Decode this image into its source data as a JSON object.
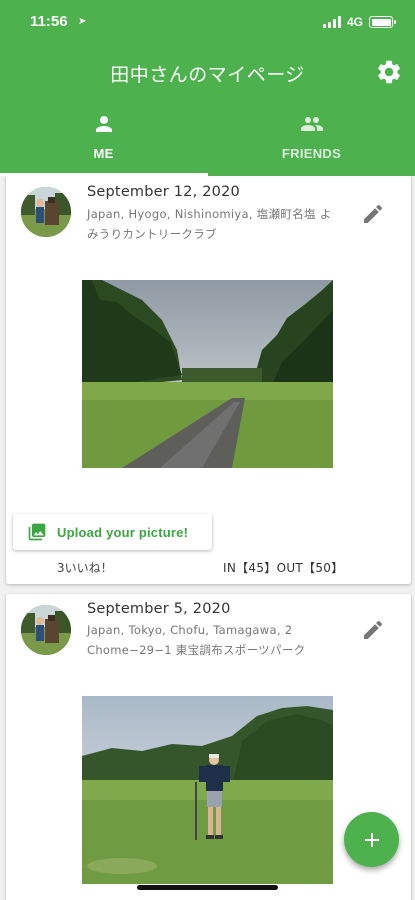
{
  "status_bar": {
    "time": "11:56",
    "network": "4G"
  },
  "header": {
    "title": "田中さんのマイページ"
  },
  "tabs": [
    {
      "label": "ME",
      "icon": "person-icon",
      "active": true
    },
    {
      "label": "FRIENDS",
      "icon": "group-icon",
      "active": false
    }
  ],
  "posts": [
    {
      "date": "September 12, 2020",
      "location": "Japan, Hyogo, Nishinomiya, 塩瀬町名塩 よみうりカントリークラブ",
      "upload_label": "Upload your picture!",
      "likes": "3いいね！",
      "score": "IN【45】OUT【50】"
    },
    {
      "date": "September 5, 2020",
      "location": "Japan, Tokyo, Chofu, Tamagawa, 2 Chome−29−1 東宝調布スポーツパーク"
    }
  ],
  "colors": {
    "brand": "#4db24e",
    "accent_text": "#3ca643"
  }
}
